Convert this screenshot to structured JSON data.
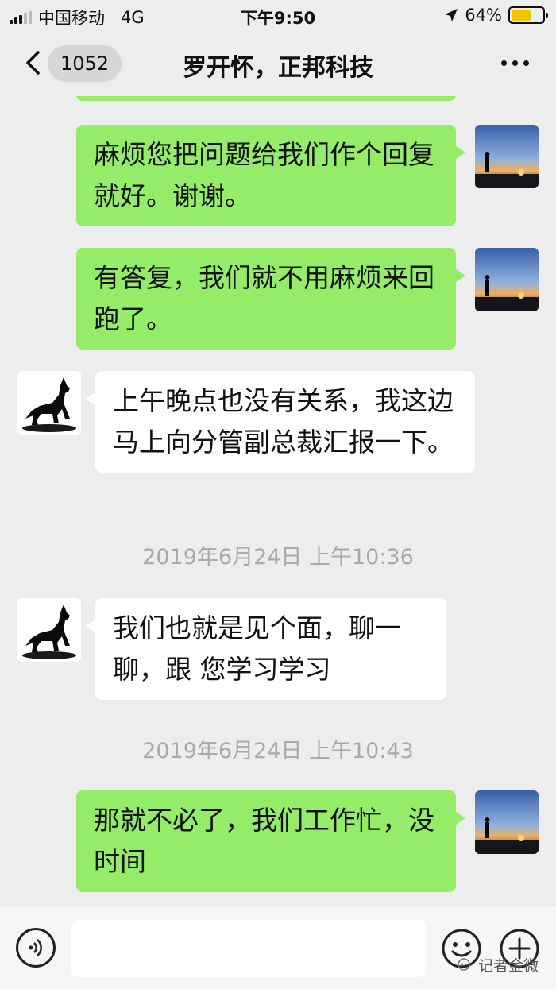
{
  "status_bar": {
    "carrier": "中国移动",
    "network": "4G",
    "time": "下午9:50",
    "battery_percent": "64%",
    "battery_level": 0.64
  },
  "nav": {
    "back_count": "1052",
    "title": "罗开怀，正邦科技"
  },
  "messages": [
    {
      "side": "out",
      "text": "麻烦您把问题给我们作个回复就好。谢谢。"
    },
    {
      "side": "out",
      "text": "有答复，我们就不用麻烦来回跑了。"
    },
    {
      "side": "in",
      "text": "上午晚点也没有关系，我这边马上向分管副总裁汇报一下。"
    },
    {
      "type": "timestamp",
      "text": "2019年6月24日 上午10:36"
    },
    {
      "side": "in",
      "text": "我们也就是见个面，聊一聊，跟 您学习学习"
    },
    {
      "type": "timestamp",
      "text": "2019年6月24日 上午10:43"
    },
    {
      "side": "out",
      "text": "那就不必了，我们工作忙，没时间"
    }
  ],
  "watermark": "记者金微",
  "colors": {
    "outgoing_bubble": "#95ec69",
    "incoming_bubble": "#ffffff",
    "background": "#ededed",
    "timestamp": "#a9a9a9"
  }
}
